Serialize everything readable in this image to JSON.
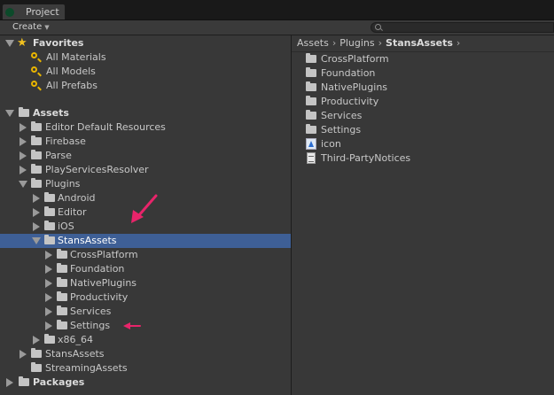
{
  "window": {
    "tab_title": "Project",
    "create_label": "Create",
    "search": {
      "placeholder": ""
    }
  },
  "colors": {
    "background": "#383838",
    "selection": "#3e5f96",
    "favorite_star": "#f0c020",
    "search_icon": "#e8b400",
    "annotation_arrow": "#e8246a"
  },
  "tree": {
    "favorites": {
      "label": "Favorites",
      "items": [
        "All Materials",
        "All Models",
        "All Prefabs"
      ]
    },
    "assets": {
      "label": "Assets",
      "children": [
        "Editor Default Resources",
        "Firebase",
        "Parse",
        "PlayServicesResolver",
        "Plugins",
        "Android",
        "Editor",
        "iOS",
        "StansAssets",
        "CrossPlatform",
        "Foundation",
        "NativePlugins",
        "Productivity",
        "Services",
        "Settings",
        "x86_64",
        "StansAssets",
        "StreamingAssets"
      ]
    },
    "packages": {
      "label": "Packages"
    }
  },
  "breadcrumb": {
    "items": [
      "Assets",
      "Plugins",
      "StansAssets"
    ]
  },
  "contents": {
    "items": [
      {
        "label": "CrossPlatform",
        "icon": "folder-icon"
      },
      {
        "label": "Foundation",
        "icon": "folder-icon"
      },
      {
        "label": "NativePlugins",
        "icon": "folder-icon"
      },
      {
        "label": "Productivity",
        "icon": "folder-icon"
      },
      {
        "label": "Services",
        "icon": "folder-icon"
      },
      {
        "label": "Settings",
        "icon": "folder-icon"
      },
      {
        "label": "icon",
        "icon": "image-asset-icon"
      },
      {
        "label": "Third-PartyNotices",
        "icon": "text-document-icon"
      }
    ]
  }
}
